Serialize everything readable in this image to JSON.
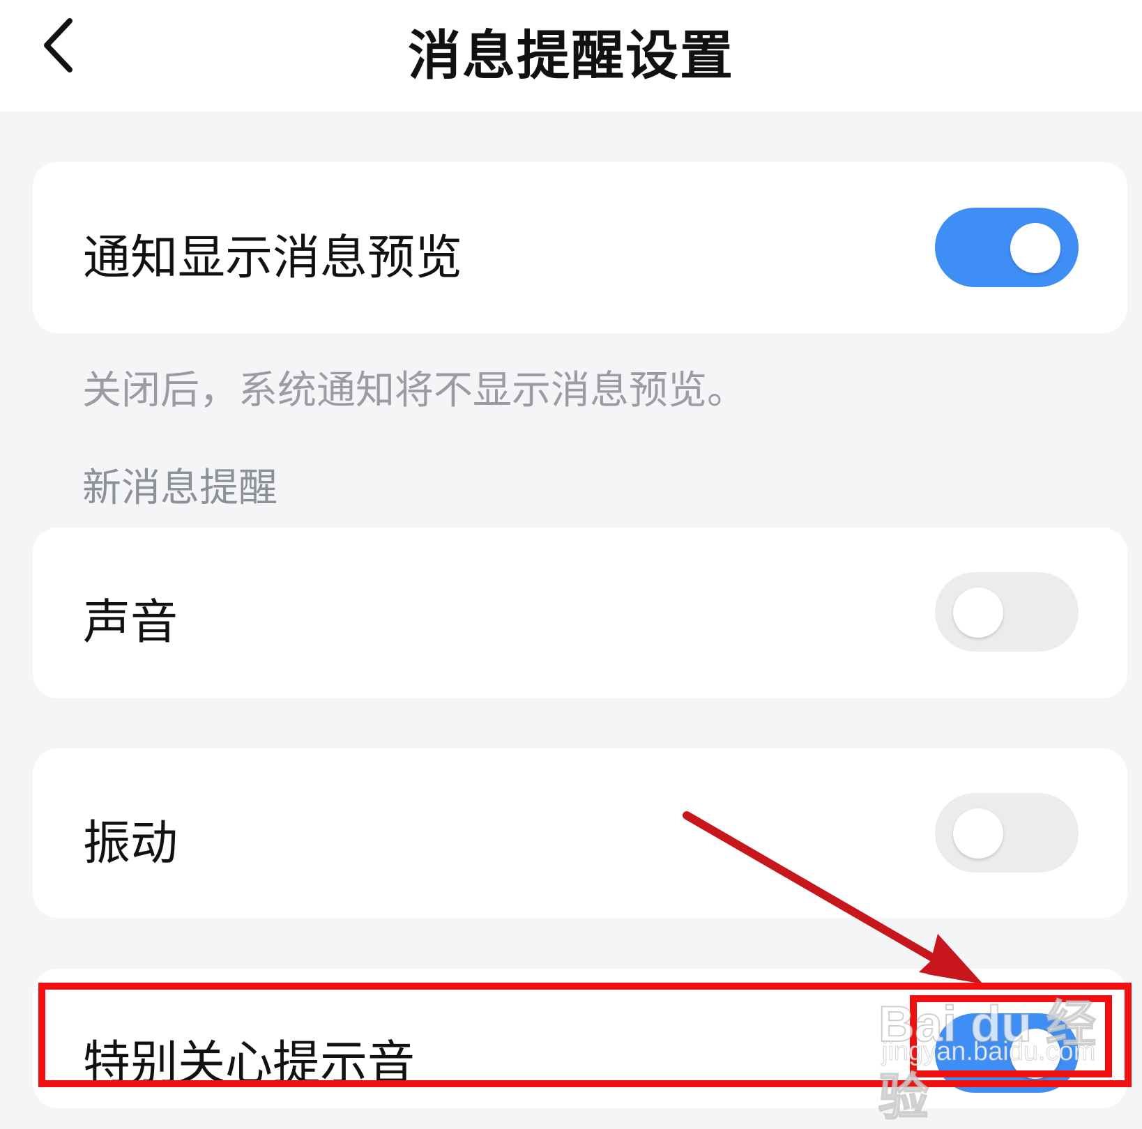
{
  "header": {
    "title": "消息提醒设置",
    "back_icon": "chevron-left-icon"
  },
  "preview_setting": {
    "label": "通知显示消息预览",
    "enabled": true
  },
  "hint": "关闭后，系统通知将不显示消息预览。",
  "new_message_section": {
    "title": "新消息提醒",
    "items": [
      {
        "label": "声音",
        "enabled": false
      },
      {
        "label": "振动",
        "enabled": false
      },
      {
        "label": "特别关心提示音",
        "enabled": true
      }
    ]
  },
  "annotations": {
    "arrow_color": "#c8161d",
    "highlight_color": "#f01010"
  },
  "watermark": {
    "brand": "Bai du 经验",
    "url": "jingyan.baidu.com"
  },
  "colors": {
    "toggle_on": "#3f8ef5",
    "toggle_off": "#ececee",
    "background": "#f4f5f7"
  }
}
